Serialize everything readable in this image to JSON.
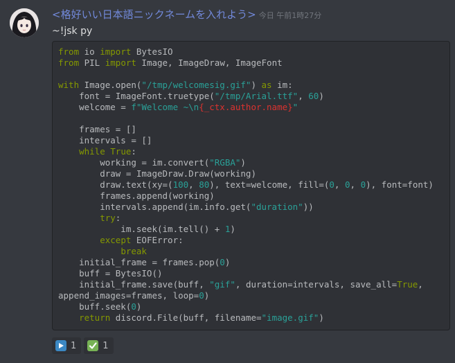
{
  "message": {
    "username": "<格好いい日本語ニックネームを入れよう>",
    "timestamp": "今日 午前1時27分",
    "content": "~!jsk py",
    "avatar_icon": "anime-girl-avatar"
  },
  "code": {
    "language": "python",
    "lines": [
      [
        {
          "t": "from",
          "c": "kw"
        },
        {
          "t": " io ",
          "c": ""
        },
        {
          "t": "import",
          "c": "kw"
        },
        {
          "t": " BytesIO",
          "c": ""
        }
      ],
      [
        {
          "t": "from",
          "c": "kw"
        },
        {
          "t": " PIL ",
          "c": ""
        },
        {
          "t": "import",
          "c": "kw"
        },
        {
          "t": " Image, ImageDraw, ImageFont",
          "c": ""
        }
      ],
      [],
      [
        {
          "t": "with",
          "c": "kw"
        },
        {
          "t": " Image.open(",
          "c": ""
        },
        {
          "t": "\"/tmp/welcomesig.gif\"",
          "c": "str"
        },
        {
          "t": ") ",
          "c": ""
        },
        {
          "t": "as",
          "c": "kw"
        },
        {
          "t": " im:",
          "c": ""
        }
      ],
      [
        {
          "t": "    font = ImageFont.truetype(",
          "c": ""
        },
        {
          "t": "\"/tmp/Arial.ttf\"",
          "c": "str"
        },
        {
          "t": ", ",
          "c": ""
        },
        {
          "t": "60",
          "c": "num"
        },
        {
          "t": ")",
          "c": ""
        }
      ],
      [
        {
          "t": "    welcome = ",
          "c": ""
        },
        {
          "t": "f\"Welcome ~\\n",
          "c": "str"
        },
        {
          "t": "{_ctx.author.name}",
          "c": "fstr"
        },
        {
          "t": "\"",
          "c": "str"
        }
      ],
      [],
      [
        {
          "t": "    frames = []",
          "c": ""
        }
      ],
      [
        {
          "t": "    intervals = []",
          "c": ""
        }
      ],
      [
        {
          "t": "    ",
          "c": ""
        },
        {
          "t": "while",
          "c": "kw"
        },
        {
          "t": " ",
          "c": ""
        },
        {
          "t": "True",
          "c": "kw"
        },
        {
          "t": ":",
          "c": ""
        }
      ],
      [
        {
          "t": "        working = im.convert(",
          "c": ""
        },
        {
          "t": "\"RGBA\"",
          "c": "str"
        },
        {
          "t": ")",
          "c": ""
        }
      ],
      [
        {
          "t": "        draw = ImageDraw.Draw(working)",
          "c": ""
        }
      ],
      [
        {
          "t": "        draw.text(xy=(",
          "c": ""
        },
        {
          "t": "100",
          "c": "num"
        },
        {
          "t": ", ",
          "c": ""
        },
        {
          "t": "80",
          "c": "num"
        },
        {
          "t": "), text=welcome, fill=(",
          "c": ""
        },
        {
          "t": "0",
          "c": "num"
        },
        {
          "t": ", ",
          "c": ""
        },
        {
          "t": "0",
          "c": "num"
        },
        {
          "t": ", ",
          "c": ""
        },
        {
          "t": "0",
          "c": "num"
        },
        {
          "t": "), font=font)",
          "c": ""
        }
      ],
      [
        {
          "t": "        frames.append(working)",
          "c": ""
        }
      ],
      [
        {
          "t": "        intervals.append(im.info.get(",
          "c": ""
        },
        {
          "t": "\"duration\"",
          "c": "str"
        },
        {
          "t": "))",
          "c": ""
        }
      ],
      [
        {
          "t": "        ",
          "c": ""
        },
        {
          "t": "try",
          "c": "kw"
        },
        {
          "t": ":",
          "c": ""
        }
      ],
      [
        {
          "t": "            im.seek(im.tell() + ",
          "c": ""
        },
        {
          "t": "1",
          "c": "num"
        },
        {
          "t": ")",
          "c": ""
        }
      ],
      [
        {
          "t": "        ",
          "c": ""
        },
        {
          "t": "except",
          "c": "kw"
        },
        {
          "t": " EOFError:",
          "c": ""
        }
      ],
      [
        {
          "t": "            ",
          "c": ""
        },
        {
          "t": "break",
          "c": "kw"
        }
      ],
      [
        {
          "t": "    initial_frame = frames.pop(",
          "c": ""
        },
        {
          "t": "0",
          "c": "num"
        },
        {
          "t": ")",
          "c": ""
        }
      ],
      [
        {
          "t": "    buff = BytesIO()",
          "c": ""
        }
      ],
      [
        {
          "t": "    initial_frame.save(buff, ",
          "c": ""
        },
        {
          "t": "\"gif\"",
          "c": "str"
        },
        {
          "t": ", duration=intervals, save_all=",
          "c": ""
        },
        {
          "t": "True",
          "c": "kw"
        },
        {
          "t": ",",
          "c": ""
        }
      ],
      [
        {
          "t": "append_images=frames, loop=",
          "c": ""
        },
        {
          "t": "0",
          "c": "num"
        },
        {
          "t": ")",
          "c": ""
        }
      ],
      [
        {
          "t": "    buff.seek(",
          "c": ""
        },
        {
          "t": "0",
          "c": "num"
        },
        {
          "t": ")",
          "c": ""
        }
      ],
      [
        {
          "t": "    ",
          "c": ""
        },
        {
          "t": "return",
          "c": "kw"
        },
        {
          "t": " discord.File(buff, filename=",
          "c": ""
        },
        {
          "t": "\"image.gif\"",
          "c": "str"
        },
        {
          "t": ")",
          "c": ""
        }
      ]
    ]
  },
  "reactions": [
    {
      "icon": "play-button-icon",
      "count": "1",
      "color": "#3b88c3"
    },
    {
      "icon": "check-mark-icon",
      "count": "1",
      "color": "#77b255"
    }
  ],
  "colors": {
    "background": "#36393f",
    "username": "#7289da",
    "keyword": "#859900",
    "string": "#2aa198",
    "fstring_expr": "#dc322f"
  }
}
